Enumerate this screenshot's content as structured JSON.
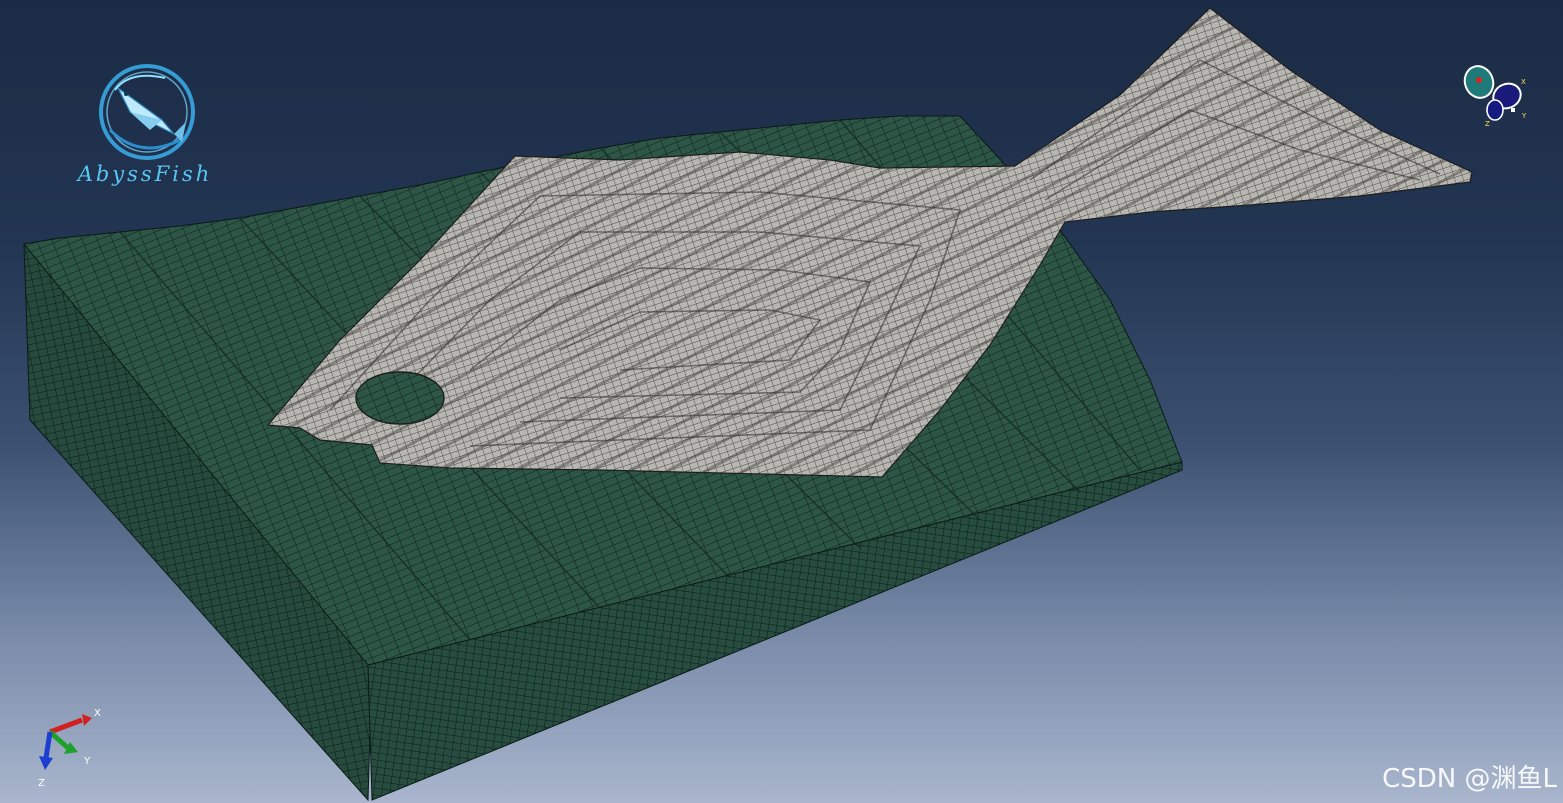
{
  "logo": {
    "text": "AbyssFish"
  },
  "triad": {
    "x_label": "X",
    "y_label": "Y",
    "z_label": "Z"
  },
  "view_cube": {
    "x_label": "X",
    "y_label": "Y",
    "z_label": "Z"
  },
  "watermark": {
    "text": "CSDN @渊鱼L"
  },
  "colors": {
    "background_top": "#1b2b45",
    "background_bottom": "#a9b6cd",
    "substrate_mesh": "#2d5647",
    "plate_mesh": "#b4b2ad",
    "logo_accent": "#58c6f3",
    "axis_x": "#d12020",
    "axis_y": "#1ea12a",
    "axis_z": "#1b3fd0"
  }
}
